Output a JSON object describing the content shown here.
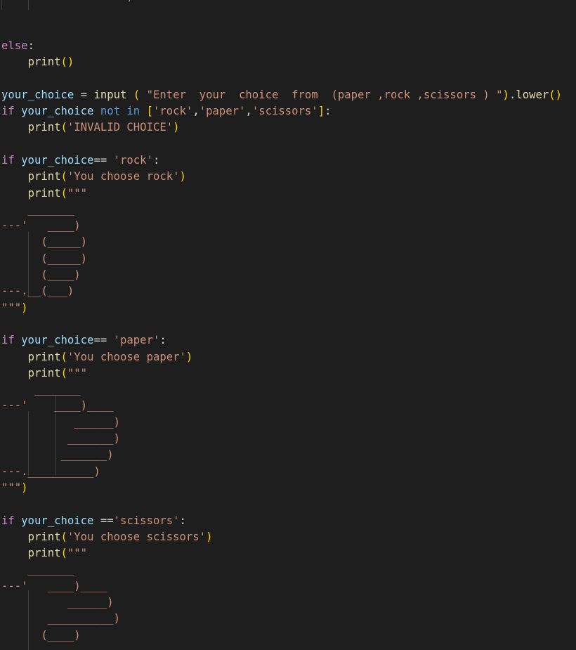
{
  "lines": [
    {
      "tokens": [
        {
          "t": "                ",
          "c": "tok-op"
        },
        {
          "t": "''')",
          "c": "tok-str"
        }
      ]
    },
    {
      "tokens": []
    },
    {
      "tokens": []
    },
    {
      "tokens": [
        {
          "t": "else",
          "c": "tok-kw"
        },
        {
          "t": ":",
          "c": "tok-op"
        }
      ]
    },
    {
      "tokens": [
        {
          "t": "    ",
          "c": "tok-op"
        },
        {
          "t": "print",
          "c": "tok-fn"
        },
        {
          "t": "()",
          "c": "tok-br"
        }
      ]
    },
    {
      "tokens": []
    },
    {
      "tokens": [
        {
          "t": "your_choice",
          "c": "tok-var"
        },
        {
          "t": " = ",
          "c": "tok-op"
        },
        {
          "t": "input",
          "c": "tok-fn"
        },
        {
          "t": " ",
          "c": "tok-op"
        },
        {
          "t": "(",
          "c": "tok-br"
        },
        {
          "t": " ",
          "c": "tok-op"
        },
        {
          "t": "\"Enter  your  choice  from  (paper ,rock ,scissors ) \"",
          "c": "tok-str"
        },
        {
          "t": ")",
          "c": "tok-br"
        },
        {
          "t": ".",
          "c": "tok-op"
        },
        {
          "t": "lower",
          "c": "tok-fn"
        },
        {
          "t": "()",
          "c": "tok-br"
        }
      ]
    },
    {
      "tokens": [
        {
          "t": "if",
          "c": "tok-kw"
        },
        {
          "t": " ",
          "c": "tok-op"
        },
        {
          "t": "your_choice",
          "c": "tok-var"
        },
        {
          "t": " ",
          "c": "tok-op"
        },
        {
          "t": "not",
          "c": "tok-blue"
        },
        {
          "t": " ",
          "c": "tok-op"
        },
        {
          "t": "in",
          "c": "tok-blue"
        },
        {
          "t": " ",
          "c": "tok-op"
        },
        {
          "t": "[",
          "c": "tok-br"
        },
        {
          "t": "'rock'",
          "c": "tok-str"
        },
        {
          "t": ",",
          "c": "tok-op"
        },
        {
          "t": "'paper'",
          "c": "tok-str"
        },
        {
          "t": ",",
          "c": "tok-op"
        },
        {
          "t": "'scissors'",
          "c": "tok-str"
        },
        {
          "t": "]",
          "c": "tok-br"
        },
        {
          "t": ":",
          "c": "tok-op"
        }
      ]
    },
    {
      "tokens": [
        {
          "t": "    ",
          "c": "tok-op"
        },
        {
          "t": "print",
          "c": "tok-fn"
        },
        {
          "t": "(",
          "c": "tok-br"
        },
        {
          "t": "'INVALID CHOICE'",
          "c": "tok-str"
        },
        {
          "t": ")",
          "c": "tok-br"
        }
      ]
    },
    {
      "tokens": []
    },
    {
      "tokens": [
        {
          "t": "if",
          "c": "tok-kw"
        },
        {
          "t": " ",
          "c": "tok-op"
        },
        {
          "t": "your_choice",
          "c": "tok-var"
        },
        {
          "t": "== ",
          "c": "tok-op"
        },
        {
          "t": "'rock'",
          "c": "tok-str"
        },
        {
          "t": ":",
          "c": "tok-op"
        }
      ]
    },
    {
      "tokens": [
        {
          "t": "    ",
          "c": "tok-op"
        },
        {
          "t": "print",
          "c": "tok-fn"
        },
        {
          "t": "(",
          "c": "tok-br"
        },
        {
          "t": "'You choose rock'",
          "c": "tok-str"
        },
        {
          "t": ")",
          "c": "tok-br"
        }
      ]
    },
    {
      "tokens": [
        {
          "t": "    ",
          "c": "tok-op"
        },
        {
          "t": "print",
          "c": "tok-fn"
        },
        {
          "t": "(",
          "c": "tok-br"
        },
        {
          "t": "\"\"\"",
          "c": "tok-str"
        }
      ]
    },
    {
      "tokens": [
        {
          "t": "    _______",
          "c": "tok-str"
        }
      ]
    },
    {
      "tokens": [
        {
          "t": "---'   ____)",
          "c": "tok-str"
        }
      ]
    },
    {
      "tokens": [
        {
          "t": "      (_____)",
          "c": "tok-str"
        }
      ]
    },
    {
      "tokens": [
        {
          "t": "      (_____)",
          "c": "tok-str"
        }
      ]
    },
    {
      "tokens": [
        {
          "t": "      (____)",
          "c": "tok-str"
        }
      ]
    },
    {
      "tokens": [
        {
          "t": "---.__(___)",
          "c": "tok-str"
        }
      ]
    },
    {
      "tokens": [
        {
          "t": "\"\"\"",
          "c": "tok-str"
        },
        {
          "t": ")",
          "c": "tok-br"
        }
      ]
    },
    {
      "tokens": []
    },
    {
      "tokens": [
        {
          "t": "if",
          "c": "tok-kw"
        },
        {
          "t": " ",
          "c": "tok-op"
        },
        {
          "t": "your_choice",
          "c": "tok-var"
        },
        {
          "t": "== ",
          "c": "tok-op"
        },
        {
          "t": "'paper'",
          "c": "tok-str"
        },
        {
          "t": ":",
          "c": "tok-op"
        }
      ]
    },
    {
      "tokens": [
        {
          "t": "    ",
          "c": "tok-op"
        },
        {
          "t": "print",
          "c": "tok-fn"
        },
        {
          "t": "(",
          "c": "tok-br"
        },
        {
          "t": "'You choose paper'",
          "c": "tok-str"
        },
        {
          "t": ")",
          "c": "tok-br"
        }
      ]
    },
    {
      "tokens": [
        {
          "t": "    ",
          "c": "tok-op"
        },
        {
          "t": "print",
          "c": "tok-fn"
        },
        {
          "t": "(",
          "c": "tok-br"
        },
        {
          "t": "\"\"\"",
          "c": "tok-str"
        }
      ]
    },
    {
      "tokens": [
        {
          "t": "     _______",
          "c": "tok-str"
        }
      ]
    },
    {
      "tokens": [
        {
          "t": "---'    ____)____",
          "c": "tok-str"
        }
      ]
    },
    {
      "tokens": [
        {
          "t": "           ______)",
          "c": "tok-str"
        }
      ]
    },
    {
      "tokens": [
        {
          "t": "          _______)",
          "c": "tok-str"
        }
      ]
    },
    {
      "tokens": [
        {
          "t": "         _______)",
          "c": "tok-str"
        }
      ]
    },
    {
      "tokens": [
        {
          "t": "---.__________)",
          "c": "tok-str"
        }
      ]
    },
    {
      "tokens": [
        {
          "t": "\"\"\"",
          "c": "tok-str"
        },
        {
          "t": ")",
          "c": "tok-br"
        }
      ]
    },
    {
      "tokens": []
    },
    {
      "tokens": [
        {
          "t": "if",
          "c": "tok-kw"
        },
        {
          "t": " ",
          "c": "tok-op"
        },
        {
          "t": "your_choice",
          "c": "tok-var"
        },
        {
          "t": " ==",
          "c": "tok-op"
        },
        {
          "t": "'scissors'",
          "c": "tok-str"
        },
        {
          "t": ":",
          "c": "tok-op"
        }
      ]
    },
    {
      "tokens": [
        {
          "t": "    ",
          "c": "tok-op"
        },
        {
          "t": "print",
          "c": "tok-fn"
        },
        {
          "t": "(",
          "c": "tok-br"
        },
        {
          "t": "'You choose scissors'",
          "c": "tok-str"
        },
        {
          "t": ")",
          "c": "tok-br"
        }
      ]
    },
    {
      "tokens": [
        {
          "t": "    ",
          "c": "tok-op"
        },
        {
          "t": "print",
          "c": "tok-fn"
        },
        {
          "t": "(",
          "c": "tok-br"
        },
        {
          "t": "\"\"\"",
          "c": "tok-str"
        }
      ]
    },
    {
      "tokens": [
        {
          "t": "    _______",
          "c": "tok-str"
        }
      ]
    },
    {
      "tokens": [
        {
          "t": "---'   ____)____",
          "c": "tok-str"
        }
      ]
    },
    {
      "tokens": [
        {
          "t": "          ______)",
          "c": "tok-str"
        }
      ]
    },
    {
      "tokens": [
        {
          "t": "       __________)",
          "c": "tok-str"
        }
      ]
    },
    {
      "tokens": [
        {
          "t": "      (____)",
          "c": "tok-str"
        }
      ]
    }
  ]
}
